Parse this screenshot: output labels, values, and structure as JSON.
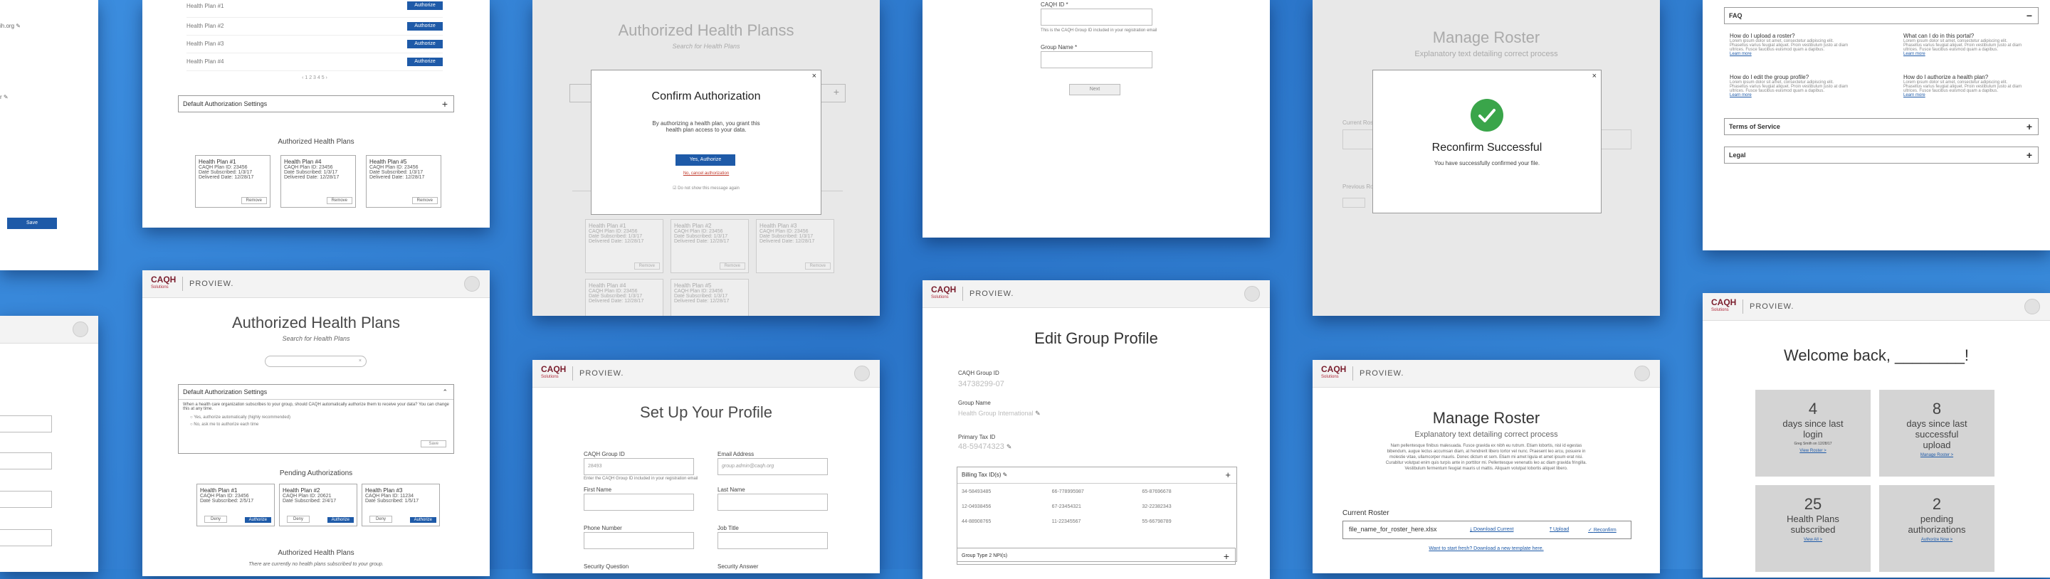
{
  "brand": {
    "logo": "CAQH",
    "logo_sub": "Solutions",
    "product": "PROVIEW."
  },
  "auth_plans_main": {
    "title": "Authorized Health Plans",
    "search_hint": "Search for Health Plans",
    "default_settings": "Default Authorization Settings",
    "settings_text": "When a health care organization subscribes to your group, should CAQH automatically authorize them to receive your data? You can change this at any time.",
    "opt_yes": "Yes, authorize automatically (highly recommended)",
    "opt_no": "No, ask me to authorize each time",
    "save": "Save",
    "pending_title": "Pending Authorizations",
    "authorized_title": "Authorized Health Plans",
    "empty_text": "There are currently no health plans subscribed to your group.",
    "deny": "Deny",
    "authorize": "Authorize",
    "pending": [
      {
        "name": "Health Plan #1",
        "id": "CAQH Plan ID: 23456",
        "sub": "Date Subscribed: 2/5/17"
      },
      {
        "name": "Health Plan #2",
        "id": "CAQH Plan ID: 20621",
        "sub": "Date Subscribed: 2/4/17"
      },
      {
        "name": "Health Plan #3",
        "id": "CAQH Plan ID: 11234",
        "sub": "Date Subscribed: 1/5/17"
      }
    ]
  },
  "auth_plans_list": {
    "rows": [
      "Health Plan #1",
      "Health Plan #2",
      "Health Plan #3",
      "Health Plan #4"
    ],
    "authorize": "Authorize",
    "default_settings": "Default Authorization Settings",
    "authorized_title": "Authorized Health Plans",
    "remove": "Remove",
    "cards": [
      {
        "name": "Health Plan #1",
        "id": "CAQH Plan ID: 23456",
        "sub": "Date Subscribed: 1/3/17",
        "del": "Delivered Date: 12/28/17"
      },
      {
        "name": "Health Plan #4",
        "id": "CAQH Plan ID: 23456",
        "sub": "Date Subscribed: 1/3/17",
        "del": "Delivered Date: 12/28/17"
      },
      {
        "name": "Health Plan #5",
        "id": "CAQH Plan ID: 23456",
        "sub": "Date Subscribed: 1/3/17",
        "del": "Delivered Date: 12/28/17"
      }
    ]
  },
  "left_edge": {
    "save": "Save"
  },
  "confirm": {
    "bg_title": "Authorized Health Planss",
    "search_hint": "Search for Health Plans",
    "title": "Confirm Authorization",
    "body": "By authorizing a health plan, you grant this health plan access to your data.",
    "yes": "Yes, Authorize",
    "no": "No, cancel authorization",
    "dont_show": "Do not show this message again",
    "close": "×",
    "bg_cards": [
      {
        "name": "Health Plan #1",
        "id": "CAQH Plan ID: 23456",
        "sub": "Date Subscribed: 1/3/17",
        "del": "Delivered Date: 12/28/17"
      },
      {
        "name": "Health Plan #2",
        "id": "CAQH Plan ID: 23456",
        "sub": "Date Subscribed: 1/3/17",
        "del": "Delivered Date: 12/28/17"
      },
      {
        "name": "Health Plan #3",
        "id": "CAQH Plan ID: 23456",
        "sub": "Date Subscribed: 1/3/17",
        "del": "Delivered Date: 12/28/17"
      },
      {
        "name": "Health Plan #4",
        "id": "CAQH Plan ID: 23456",
        "sub": "Date Subscribed: 1/3/17",
        "del": "Delivered Date: 12/28/17"
      },
      {
        "name": "Health Plan #5",
        "id": "CAQH Plan ID: 23456",
        "sub": "Date Subscribed: 1/3/17",
        "del": "Delivered Date: 12/28/17"
      }
    ],
    "remove": "Remove"
  },
  "setup": {
    "title": "Set Up Your Profile",
    "group_id_label": "CAQH Group ID",
    "group_id_val": "28493",
    "group_id_hint": "Enter the CAQH Group ID included in your registration email",
    "email_label": "Email Address",
    "email_ph": "group.admin@caqh.org",
    "first": "First Name",
    "last": "Last Name",
    "phone": "Phone Number",
    "job": "Job Title",
    "secq": "Security Question",
    "seca": "Security Answer"
  },
  "setup_top": {
    "group_id_label": "CAQH ID *",
    "hint": "This is the CAQH Group ID included in your registration email",
    "group_name_label": "Group Name *",
    "next": "Next"
  },
  "edit": {
    "title": "Edit Group Profile",
    "gid_label": "CAQH Group ID",
    "gid": "34738299-07",
    "gname_label": "Group Name",
    "gname": "Health Group International",
    "tax_label": "Primary Tax ID",
    "tax": "48-59474323",
    "billing": "Billing Tax ID(s)",
    "ids": [
      "34-58493485",
      "66-778995987",
      "65-87696678",
      "12-04938456",
      "67-23454321",
      "32-22382343",
      "44-88908765",
      "11-22345567",
      "55-66798789"
    ],
    "group_type": "Group Type 2 NPI(s)"
  },
  "roster_modal": {
    "bg_title": "Manage Roster",
    "bg_sub": "Explanatory text detailing correct process",
    "bg_current": "Current Roster",
    "bg_previous": "Previous Rosters",
    "title": "Reconfirm Successful",
    "body": "You have successfully confirmed your file.",
    "close": "×"
  },
  "roster": {
    "title": "Manage Roster",
    "sub": "Explanatory text detailing correct process",
    "lorem": "Nam pellentesque finibus malesuada. Fusce gravida ex nibh eu rutrum. Etiam lobortis, nisl id egestas bibendum, augue lectus accumsan diam, at hendrerit libero tortor vel nunc. Praesent leo arcu, posuere in molestie vitae, ullamcorper mauris. Donec dictum et sem. Etiam mi amet ligula et amet ipsum erat nisi. Curabitur volutpat enim quis turpis ante in porttitor mi. Pellentesque venenatis leo ac diam gravida fringilla. Vestibulum fermentum feugiat mauris ut mattis. Aliquam volutpat lobortis aliquet libero.",
    "current": "Current Roster",
    "file": "file_name_for_roster_here.xlsx",
    "download": "Download Current",
    "upload": "Upload",
    "reconfirm": "Reconfirm",
    "start": "Want to start fresh? Download a new template here."
  },
  "faq": {
    "faq": "FAQ",
    "q1": "How do I upload a roster?",
    "q2": "What can I do in this portal?",
    "q3": "How do I edit the group profile?",
    "q4": "How do I authorize a health plan?",
    "lorem": "Lorem ipsum dolor sit amet, consectetur adipiscing elit. Phasellus varius feugiat aliquet. Proin vestibulum justo at diam ultrices. Fusce faucibus euismod quam a dapibus.",
    "learn": "Learn more",
    "tos": "Terms of Service",
    "legal": "Legal",
    "minus": "−",
    "plus": "+"
  },
  "welcome": {
    "title": "Welcome back, ________!",
    "tiles": [
      {
        "n": "4",
        "t": "days since last login",
        "s": "Greg Smith on 12/28/17",
        "l": "View Roster >"
      },
      {
        "n": "8",
        "t": "days since last successful upload",
        "s": "",
        "l": "Manage Roster >"
      },
      {
        "n": "25",
        "t": "Health Plans subscribed",
        "s": "",
        "l": "View All >"
      },
      {
        "n": "2",
        "t": "pending authorizations",
        "s": "",
        "l": "Authorize Now >"
      }
    ]
  }
}
